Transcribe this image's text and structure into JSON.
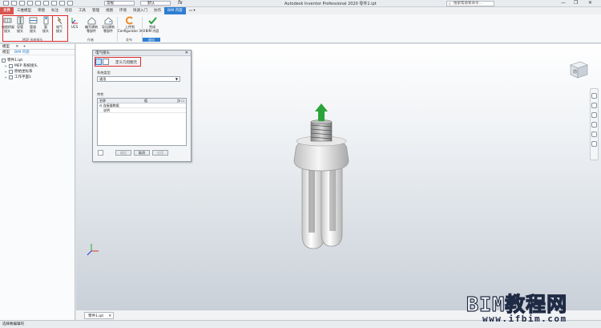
{
  "app": {
    "title": "Autodesk Inventor Professional 2020   零件1.ipt"
  },
  "quick_access": {
    "style_value": "常规",
    "material_value": "默认",
    "fx_label": "fx"
  },
  "search": {
    "placeholder": "搜索帮助和命令..."
  },
  "window_controls": {
    "minimize": "—",
    "restore": "❐",
    "close": "✕"
  },
  "tabs": [
    "文件",
    "三维模型",
    "草图",
    "标注",
    "检验",
    "工具",
    "管理",
    "视图",
    "环境",
    "快速入门",
    "协作",
    "BIM 内容"
  ],
  "ribbon": {
    "buttons": [
      {
        "label": "电缆桥架\n接头",
        "icon": "cable-tray-connector-icon"
      },
      {
        "label": "导管\n接头",
        "icon": "conduit-connector-icon"
      },
      {
        "label": "管道\n接头",
        "icon": "pipe-connector-icon"
      },
      {
        "label": "管\n接头",
        "icon": "tube-connector-icon"
      },
      {
        "label": "电气\n接头",
        "icon": "electrical-connector-icon"
      },
      {
        "label": "UCS",
        "icon": "ucs-icon"
      },
      {
        "label": "编写建筑\n零部件",
        "icon": "author-building-component-icon"
      },
      {
        "label": "导出建筑\n零部件",
        "icon": "export-building-component-icon"
      },
      {
        "label": "上传到\nConfigurator 360",
        "icon": "configurator-360-icon"
      },
      {
        "label": "完成\nBIM 内容",
        "icon": "finish-bim-icon"
      }
    ],
    "panels": [
      "MEP 系统接头",
      "作者",
      "发布",
      "退出"
    ]
  },
  "browser": {
    "header": "模型",
    "close": "✕",
    "plus": "+",
    "tabs": [
      "模型",
      "BIM 内容"
    ],
    "tree": [
      {
        "label": "零件1.ipt",
        "indent": 0,
        "expander": ""
      },
      {
        "label": "MEP 系统接头",
        "indent": 1,
        "expander": "+"
      },
      {
        "label": "原始坐标系",
        "indent": 1,
        "expander": "+"
      },
      {
        "label": "工作平面1",
        "indent": 1,
        "expander": "+"
      }
    ]
  },
  "dialog": {
    "title": "电气接头",
    "close": "✕",
    "tool_action": "定义几何图元",
    "system_type_label": "系统类型",
    "system_type_value": "通用",
    "properties_label": "特性",
    "prop_headers": [
      "名称",
      "值"
    ],
    "prop_group": "连接器数据",
    "prop_rows": [
      {
        "name": "说明",
        "value": ""
      }
    ],
    "buttons": {
      "apply": "确定",
      "cancel": "取消",
      "close": "应用"
    }
  },
  "viewcube": {
    "face": "前"
  },
  "document_tab": {
    "label": "零件1.ipt",
    "close": "✕"
  },
  "status": {
    "text": "选择要编辑的"
  },
  "watermark": {
    "big": "BIM教程网",
    "url": "www.ifbim.com"
  },
  "colors": {
    "accent": "#2d7ed3",
    "file_tab": "#d9534f",
    "highlight": "#e0282a",
    "arrow": "#2aa33a"
  }
}
